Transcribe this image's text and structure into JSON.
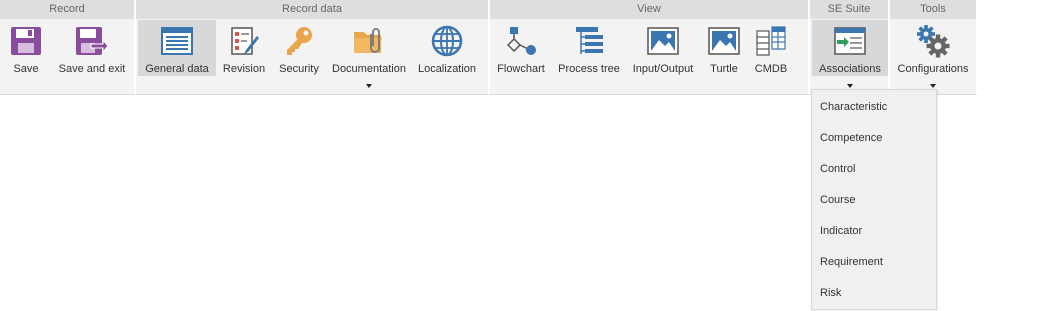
{
  "groups": {
    "record": {
      "title": "Record",
      "save": "Save",
      "save_exit": "Save and exit"
    },
    "record_data": {
      "title": "Record data",
      "general_data": "General data",
      "revision": "Revision",
      "security": "Security",
      "documentation": "Documentation",
      "localization": "Localization"
    },
    "view": {
      "title": "View",
      "flowchart": "Flowchart",
      "process_tree": "Process tree",
      "input_output": "Input/Output",
      "turtle": "Turtle",
      "cmdb": "CMDB"
    },
    "se_suite": {
      "title": "SE Suite",
      "associations": "Associations"
    },
    "tools": {
      "title": "Tools",
      "configurations": "Configurations"
    }
  },
  "associations_menu": {
    "items": [
      "Characteristic",
      "Competence",
      "Control",
      "Course",
      "Indicator",
      "Requirement",
      "Risk"
    ]
  },
  "colors": {
    "purple_icon": "#8a4d9c",
    "blue_icon": "#3a76b0",
    "orange_icon": "#e8a54a",
    "active_tab": "#d8d8d8"
  },
  "icons": {
    "save": "floppy-disk-icon",
    "save_exit": "floppy-disk-exit-icon",
    "general_data": "form-window-icon",
    "revision": "document-pencil-icon",
    "security": "key-icon",
    "documentation": "folder-paperclip-icon",
    "localization": "globe-icon",
    "flowchart": "flowchart-icon",
    "process_tree": "tree-list-icon",
    "input_output": "image-window-icon",
    "turtle": "image-window-icon",
    "cmdb": "server-table-icon",
    "associations": "window-arrow-icon",
    "configurations": "gears-icon"
  }
}
